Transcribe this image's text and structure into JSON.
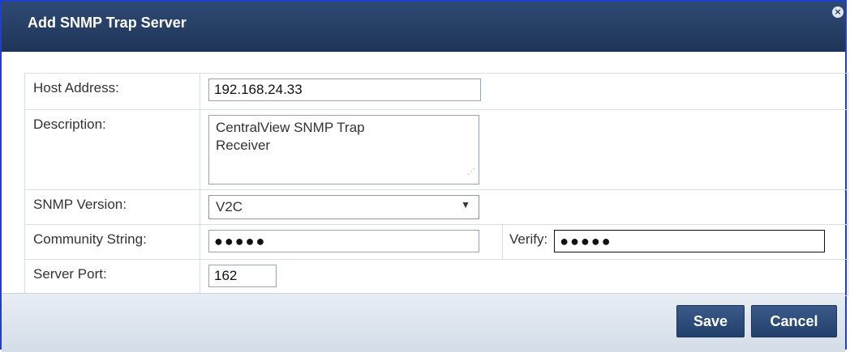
{
  "dialog": {
    "title": "Add SNMP Trap Server",
    "close_icon": "close-icon"
  },
  "form": {
    "host_address": {
      "label": "Host Address:",
      "value": "192.168.24.33"
    },
    "description": {
      "label": "Description:",
      "value_line1": "CentralView SNMP Trap",
      "value_line2": "Receiver"
    },
    "snmp_version": {
      "label": "SNMP Version:",
      "value": "V2C"
    },
    "community_string": {
      "label": "Community String:",
      "value": "●●●●●",
      "verify_label": "Verify:",
      "verify_value": "●●●●●"
    },
    "server_port": {
      "label": "Server Port:",
      "value": "162"
    }
  },
  "buttons": {
    "save": "Save",
    "cancel": "Cancel"
  },
  "colors": {
    "titlebar": "#26416a",
    "border": "#1f3fd0",
    "button": "#2f4d7a"
  }
}
